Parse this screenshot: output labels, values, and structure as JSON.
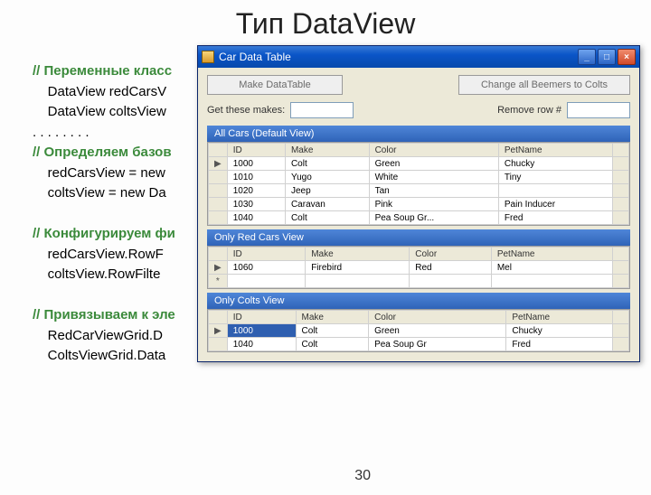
{
  "slide": {
    "title": "Тип DataView",
    "page_number": "30"
  },
  "code": {
    "c1": "// Переменные класс",
    "l1": "    DataView redCarsV",
    "l2": "    DataView coltsView",
    "dots": ". . . . . . . .",
    "c2": "// Определяем базов",
    "l3": "    redCarsView = new",
    "l4": "    coltsView = new Da",
    "c3": "// Конфигурируем фи",
    "l5": "    redCarsView.RowF",
    "l6": "    coltsView.RowFilte",
    "c4": "// Привязываем к эле",
    "l7": "    RedCarViewGrid.D",
    "l8": "    ColtsViewGrid.Data"
  },
  "window": {
    "title": "Car Data Table",
    "buttons": {
      "make_table": "Make DataTable",
      "change_beemers": "Change all Beemers to Colts",
      "get_makes": "Get these makes:",
      "remove_row": "Remove row #"
    },
    "sections": {
      "all": "All Cars (Default View)",
      "red": "Only Red Cars View",
      "colts": "Only Colts View"
    },
    "columns": [
      "ID",
      "Make",
      "Color",
      "PetName"
    ],
    "all_rows": [
      {
        "id": "1000",
        "make": "Colt",
        "color": "Green",
        "pet": "Chucky"
      },
      {
        "id": "1010",
        "make": "Yugo",
        "color": "White",
        "pet": "Tiny"
      },
      {
        "id": "1020",
        "make": "Jeep",
        "color": "Tan",
        "pet": ""
      },
      {
        "id": "1030",
        "make": "Caravan",
        "color": "Pink",
        "pet": "Pain Inducer"
      },
      {
        "id": "1040",
        "make": "Colt",
        "color": "Pea Soup Gr...",
        "pet": "Fred"
      }
    ],
    "red_rows": [
      {
        "id": "1060",
        "make": "Firebird",
        "color": "Red",
        "pet": "Mel"
      }
    ],
    "colts_rows": [
      {
        "id": "1000",
        "make": "Colt",
        "color": "Green",
        "pet": "Chucky"
      },
      {
        "id": "1040",
        "make": "Colt",
        "color": "Pea Soup Gr",
        "pet": "Fred"
      }
    ]
  }
}
